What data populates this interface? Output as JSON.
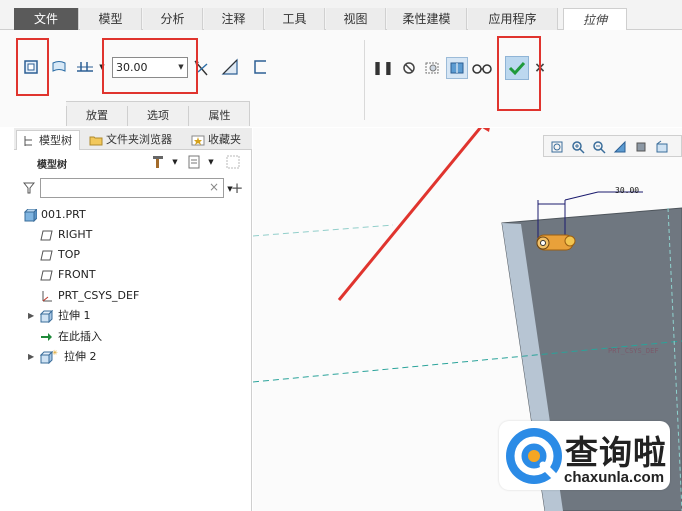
{
  "ribbon_tabs": [
    "文件",
    "模型",
    "分析",
    "注释",
    "工具",
    "视图",
    "柔性建模",
    "应用程序"
  ],
  "active_tab": "拉伸",
  "depth": {
    "value": "30.00"
  },
  "sub_tabs": [
    "放置",
    "选项",
    "属性"
  ],
  "panel_tabs": [
    "模型树",
    "文件夹浏览器",
    "收藏夹"
  ],
  "model_tree": {
    "header": "模型树",
    "search_value": "",
    "items": [
      {
        "label": "001.PRT",
        "icon": "part-icon",
        "expandable": false
      },
      {
        "label": "RIGHT",
        "icon": "datum-plane-icon",
        "expandable": false
      },
      {
        "label": "TOP",
        "icon": "datum-plane-icon",
        "expandable": false
      },
      {
        "label": "FRONT",
        "icon": "datum-plane-icon",
        "expandable": false
      },
      {
        "label": "PRT_CSYS_DEF",
        "icon": "csys-icon",
        "expandable": false
      },
      {
        "label": "拉伸 1",
        "icon": "extrude-icon",
        "expandable": true
      },
      {
        "label": "在此插入",
        "icon": "insert-arrow-icon",
        "expandable": false
      },
      {
        "label": "拉伸 2",
        "icon": "extrude-icon",
        "expandable": true
      }
    ]
  },
  "canvas": {
    "dimension_label": "30.00",
    "csys_label": "PRT_CSYS_DEF"
  },
  "watermark": {
    "brand": "查询啦",
    "domain": "chaxunla.com"
  },
  "colors": {
    "highlight": "#e0342e",
    "confirm": "#1f9a3a",
    "part_face": "#6f7780",
    "feature": "#e9a13a"
  }
}
